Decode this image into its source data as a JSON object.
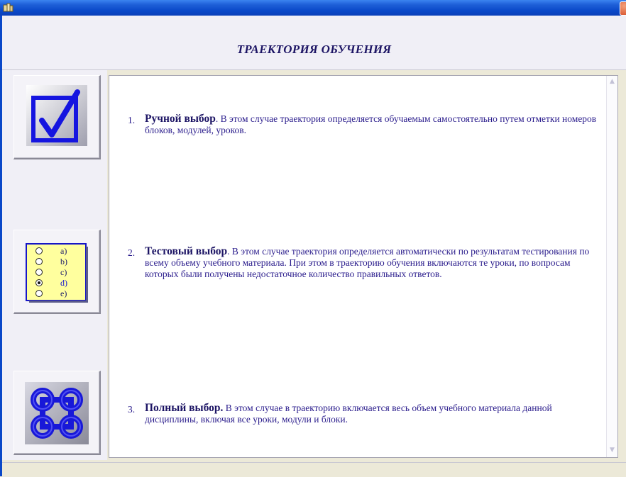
{
  "window": {
    "app_icon": "app-icon",
    "close_icon": "close-icon"
  },
  "header": {
    "title": "ТРАЕКТОРИЯ ОБУЧЕНИЯ"
  },
  "icons": [
    {
      "name": "checkbox-check-icon"
    },
    {
      "name": "radio-list-icon",
      "options": [
        "a)",
        "b)",
        "c)",
        "d)",
        "e)"
      ],
      "selected": "d)"
    },
    {
      "name": "command-knot-icon"
    }
  ],
  "items": [
    {
      "number": "1.",
      "title": "Ручной выбор",
      "text": ". В этом случае траектория определяется обучаемым самостоятельно путем отметки номеров блоков, модулей, уроков."
    },
    {
      "number": "2.",
      "title": "Тестовый выбор",
      "text": ". В этом случае траектория определяется автоматически по результатам тестирования по всему объему учебного материала. При этом в траекторию обучения включаются те уроки, по вопросам которых были получены недостаточное количество правильных ответов."
    },
    {
      "number": "3.",
      "title": "Полный выбор.",
      "text": " В этом случае в траекторию включается весь объем учебного материала данной дисциплины, включая все уроки, модули и блоки."
    }
  ],
  "scrollbar": {
    "up": "▲",
    "down": "▼"
  }
}
